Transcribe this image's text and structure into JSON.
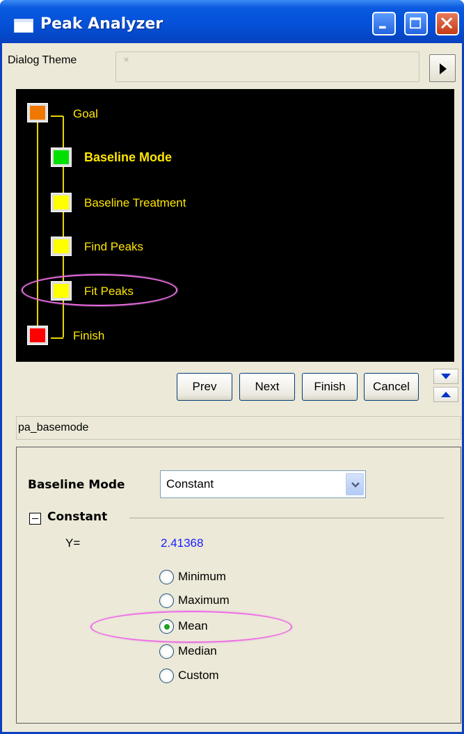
{
  "window": {
    "title": "Peak Analyzer"
  },
  "dialog_theme": {
    "label": "Dialog Theme",
    "value": "×"
  },
  "wizard_tree": {
    "nodes": [
      {
        "label": "Goal",
        "color": "#f07800",
        "state": "normal"
      },
      {
        "label": "Baseline Mode",
        "color": "#00e000",
        "state": "current"
      },
      {
        "label": "Baseline Treatment",
        "color": "#ffff00",
        "state": "normal"
      },
      {
        "label": "Find Peaks",
        "color": "#ffff00",
        "state": "normal"
      },
      {
        "label": "Fit Peaks",
        "color": "#ffff00",
        "state": "highlighted"
      },
      {
        "label": "Finish",
        "color": "#ff0000",
        "state": "normal"
      }
    ]
  },
  "nav_buttons": {
    "prev": "Prev",
    "next": "Next",
    "finish": "Finish",
    "cancel": "Cancel"
  },
  "page_name": "pa_basemode",
  "settings": {
    "baseline_mode_label": "Baseline Mode",
    "baseline_mode_value": "Constant",
    "group_title": "Constant",
    "y_label": "Y=",
    "y_value": "2.41368",
    "options": [
      {
        "label": "Minimum",
        "selected": false
      },
      {
        "label": "Maximum",
        "selected": false
      },
      {
        "label": "Mean",
        "selected": true
      },
      {
        "label": "Median",
        "selected": false
      },
      {
        "label": "Custom",
        "selected": false
      }
    ]
  },
  "colors": {
    "title_bar": "#0551d9",
    "tree_background": "#000000",
    "tree_text": "#ffe600",
    "y_value": "#1a1aff",
    "annotation": "#f06ce8"
  }
}
